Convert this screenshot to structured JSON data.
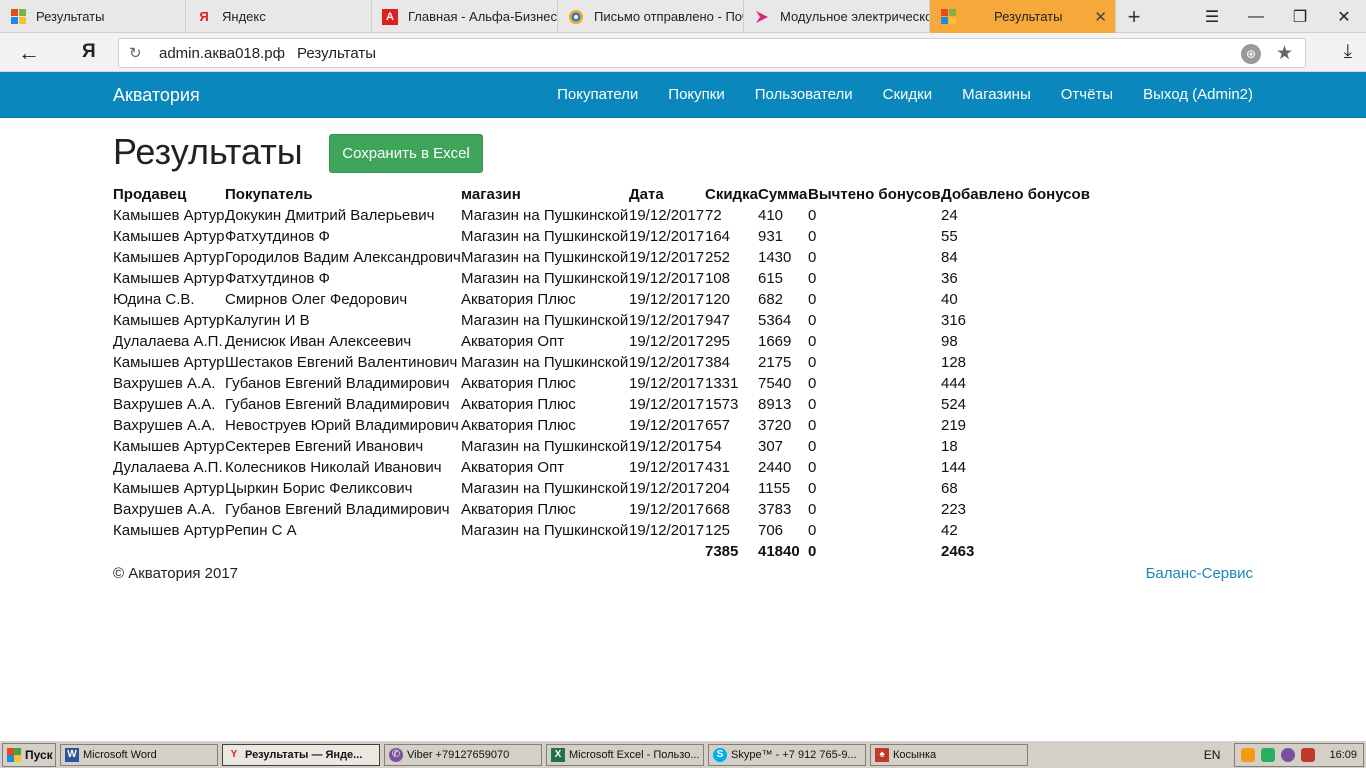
{
  "browser": {
    "tabs": [
      {
        "label": "Результаты",
        "icon": "grid-favicon-icon",
        "active": false
      },
      {
        "label": "Яндекс",
        "icon": "yandex-icon",
        "active": false
      },
      {
        "label": "Главная - Альфа-Бизнес",
        "icon": "alfa-icon",
        "active": false
      },
      {
        "label": "Письмо отправлено - Поч",
        "icon": "mail-icon",
        "active": false
      },
      {
        "label": "Модульное электрическо",
        "icon": "arrow-icon",
        "active": false
      },
      {
        "label": "Результаты",
        "icon": "grid-favicon-icon",
        "active": true
      }
    ],
    "url": "admin.аква018.рф",
    "page_title": "Результаты"
  },
  "site": {
    "brand": "Акватория",
    "nav": [
      "Покупатели",
      "Покупки",
      "Пользователи",
      "Скидки",
      "Магазины",
      "Отчёты",
      "Выход (Admin2)"
    ]
  },
  "main": {
    "title": "Результаты",
    "excel_button": "Сохранить в Excel",
    "columns": [
      "Продавец",
      "Покупатель",
      "магазин",
      "Дата",
      "Скидка",
      "Сумма",
      "Вычтено бонусов",
      "Добавлено бонусов"
    ],
    "rows": [
      [
        "Камышев Артур",
        "Докукин Дмитрий Валерьевич",
        "Магазин на Пушкинской",
        "19/12/2017",
        "72",
        "410",
        "0",
        "24"
      ],
      [
        "Камышев Артур",
        "Фатхутдинов Ф",
        "Магазин на Пушкинской",
        "19/12/2017",
        "164",
        "931",
        "0",
        "55"
      ],
      [
        "Камышев Артур",
        "Городилов Вадим Александрович",
        "Магазин на Пушкинской",
        "19/12/2017",
        "252",
        "1430",
        "0",
        "84"
      ],
      [
        "Камышев Артур",
        "Фатхутдинов Ф",
        "Магазин на Пушкинской",
        "19/12/2017",
        "108",
        "615",
        "0",
        "36"
      ],
      [
        "Юдина С.В.",
        "Смирнов Олег Федорович",
        "Акватория Плюс",
        "19/12/2017",
        "120",
        "682",
        "0",
        "40"
      ],
      [
        "Камышев Артур",
        "Калугин И В",
        "Магазин на Пушкинской",
        "19/12/2017",
        "947",
        "5364",
        "0",
        "316"
      ],
      [
        "Дулалаева А.П.",
        "Денисюк Иван Алексеевич",
        "Акватория Опт",
        "19/12/2017",
        "295",
        "1669",
        "0",
        "98"
      ],
      [
        "Камышев Артур",
        "Шестаков Евгений Валентинович",
        "Магазин на Пушкинской",
        "19/12/2017",
        "384",
        "2175",
        "0",
        "128"
      ],
      [
        "Вахрушев А.А.",
        "Губанов Евгений Владимирович",
        "Акватория Плюс",
        "19/12/2017",
        "1331",
        "7540",
        "0",
        "444"
      ],
      [
        "Вахрушев А.А.",
        "Губанов Евгений Владимирович",
        "Акватория Плюс",
        "19/12/2017",
        "1573",
        "8913",
        "0",
        "524"
      ],
      [
        "Вахрушев А.А.",
        "Невоструев Юрий Владимирович",
        "Акватория Плюс",
        "19/12/2017",
        "657",
        "3720",
        "0",
        "219"
      ],
      [
        "Камышев Артур",
        "Сектерев Евгений Иванович",
        "Магазин на Пушкинской",
        "19/12/2017",
        "54",
        "307",
        "0",
        "18"
      ],
      [
        "Дулалаева А.П.",
        "Колесников Николай Иванович",
        "Акватория Опт",
        "19/12/2017",
        "431",
        "2440",
        "0",
        "144"
      ],
      [
        "Камышев Артур",
        "Цыркин Борис Феликсович",
        "Магазин на Пушкинской",
        "19/12/2017",
        "204",
        "1155",
        "0",
        "68"
      ],
      [
        "Вахрушев А.А.",
        "Губанов Евгений Владимирович",
        "Акватория Плюс",
        "19/12/2017",
        "668",
        "3783",
        "0",
        "223"
      ],
      [
        "Камышев Артур",
        "Репин С А",
        "Магазин на Пушкинской",
        "19/12/2017",
        "125",
        "706",
        "0",
        "42"
      ]
    ],
    "totals": [
      "",
      "",
      "",
      "",
      "7385",
      "41840",
      "0",
      "2463"
    ]
  },
  "footer": {
    "copyright": "© Акватория 2017",
    "link": "Баланс-Сервис"
  },
  "taskbar": {
    "start": "Пуск",
    "items": [
      {
        "label": "Microsoft Word",
        "icon": "word-icon",
        "color": "#2b579a",
        "active": false
      },
      {
        "label": "Результаты — Янде...",
        "icon": "yandex-browser-icon",
        "color": "#e02020",
        "active": true
      },
      {
        "label": "Viber +79127659070",
        "icon": "viber-icon",
        "color": "#7b519d",
        "active": false
      },
      {
        "label": "Microsoft Excel - Пользо...",
        "icon": "excel-icon",
        "color": "#217346",
        "active": false
      },
      {
        "label": "Skype™ - +7 912 765-9...",
        "icon": "skype-icon",
        "color": "#00aff0",
        "active": false
      },
      {
        "label": "Косынка",
        "icon": "solitaire-icon",
        "color": "#c0392b",
        "active": false
      }
    ],
    "lang": "EN",
    "time": "16:09"
  },
  "colors": {
    "navbar": "#0a88bd",
    "active_tab": "#f7a83a",
    "excel_button": "#3fa55a",
    "link": "#1a86b8"
  }
}
